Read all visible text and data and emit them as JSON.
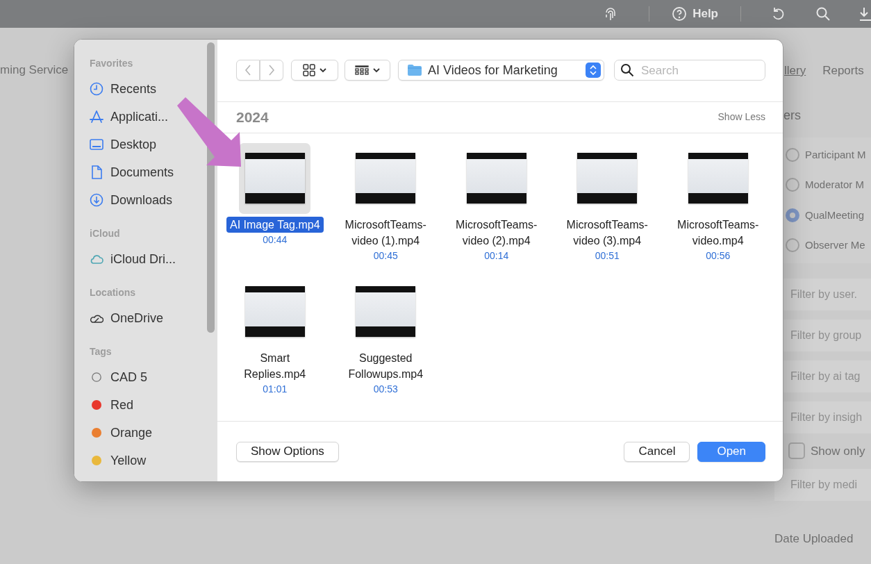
{
  "app": {
    "top_bar": {
      "help_label": "Help"
    },
    "nav_left": "ming Service",
    "nav_tabs": [
      {
        "label": "llery",
        "selected": true
      },
      {
        "label": "Reports",
        "selected": false
      }
    ],
    "panel": {
      "heading": "ers",
      "radios": [
        {
          "label": "Participant M",
          "selected": false
        },
        {
          "label": "Moderator M",
          "selected": false
        },
        {
          "label": "QualMeeting",
          "selected": true
        },
        {
          "label": "Observer Me",
          "selected": false
        }
      ],
      "filters": [
        {
          "kind": "field",
          "placeholder": "Filter by user."
        },
        {
          "kind": "field",
          "placeholder": "Filter by group"
        },
        {
          "kind": "field",
          "placeholder": "Filter by ai tag"
        },
        {
          "kind": "field",
          "placeholder": "Filter by insigh"
        },
        {
          "kind": "checkbox",
          "label": "Show only",
          "checked": false
        },
        {
          "kind": "field",
          "placeholder": "Filter by medi"
        }
      ],
      "date_label": "Date Uploaded"
    }
  },
  "dialog": {
    "sidebar": [
      {
        "title": "Favorites",
        "items": [
          {
            "kind": "clock",
            "label": "Recents"
          },
          {
            "kind": "apps",
            "label": "Applicati..."
          },
          {
            "kind": "desktop",
            "label": "Desktop"
          },
          {
            "kind": "document",
            "label": "Documents"
          },
          {
            "kind": "download",
            "label": "Downloads"
          }
        ]
      },
      {
        "title": "iCloud",
        "items": [
          {
            "kind": "cloud",
            "label": "iCloud Dri..."
          }
        ]
      },
      {
        "title": "Locations",
        "items": [
          {
            "kind": "onedrive",
            "label": "OneDrive"
          }
        ]
      },
      {
        "title": "Tags",
        "items": [
          {
            "kind": "tag-outline",
            "label": "CAD 5"
          },
          {
            "kind": "tag",
            "label": "Red",
            "color": "#e8372c"
          },
          {
            "kind": "tag",
            "label": "Orange",
            "color": "#ea7f31"
          },
          {
            "kind": "tag",
            "label": "Yellow",
            "color": "#e9b83c"
          }
        ]
      }
    ],
    "toolbar": {
      "back": {
        "disabled": true
      },
      "forward": {
        "disabled": true
      },
      "path": "AI Videos for Marketing",
      "search": {
        "placeholder": "Search"
      }
    },
    "section": {
      "title": "2024",
      "toggle": "Show Less"
    },
    "files": [
      {
        "name": "AI Image Tag.mp4",
        "duration": "00:44",
        "selected": true
      },
      {
        "name": "MicrosoftTeams-video (1).mp4",
        "duration": "00:45",
        "selected": false
      },
      {
        "name": "MicrosoftTeams-video (2).mp4",
        "duration": "00:14",
        "selected": false
      },
      {
        "name": "MicrosoftTeams-video (3).mp4",
        "duration": "00:51",
        "selected": false
      },
      {
        "name": "MicrosoftTeams-video.mp4",
        "duration": "00:56",
        "selected": false
      },
      {
        "name": "Smart Replies.mp4",
        "duration": "01:01",
        "selected": false
      },
      {
        "name": "Suggested Followups.mp4",
        "duration": "00:53",
        "selected": false
      }
    ],
    "buttons": {
      "options": "Show Options",
      "cancel": "Cancel",
      "open": "Open"
    }
  }
}
